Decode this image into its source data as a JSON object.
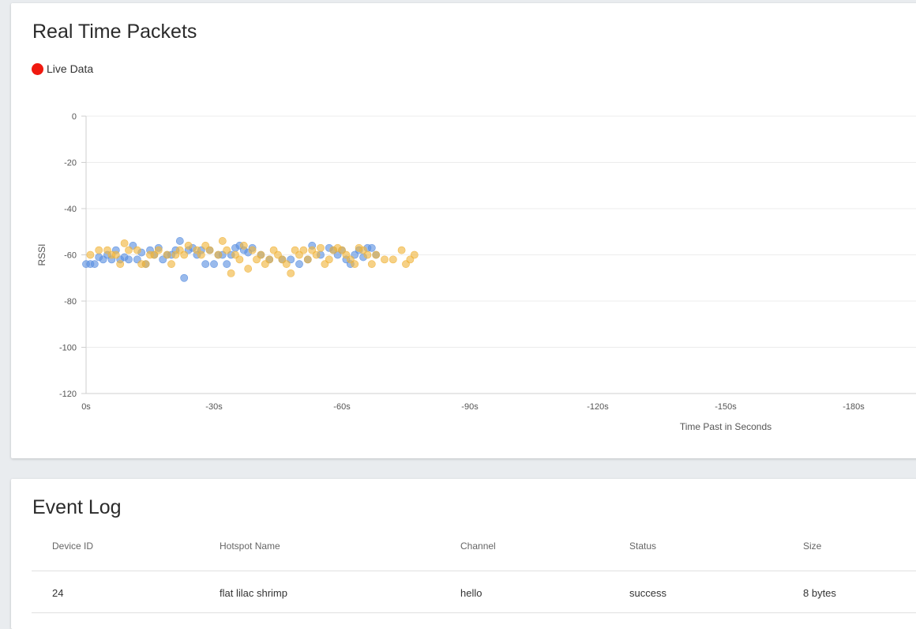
{
  "packets_card": {
    "title": "Real Time Packets",
    "legend_label": "Live Data"
  },
  "colors": {
    "live_dot": "#f0190f",
    "series_blue": "#5a8fe0",
    "series_orange": "#f0b43c"
  },
  "chart_data": {
    "type": "scatter",
    "xlabel": "Time Past in Seconds",
    "ylabel": "RSSI",
    "x_ticks": [
      "0s",
      "-30s",
      "-60s",
      "-90s",
      "-120s",
      "-150s",
      "-180s"
    ],
    "y_ticks": [
      0,
      -20,
      -40,
      -60,
      -80,
      -100,
      -120
    ],
    "xlim": [
      0,
      -195
    ],
    "ylim": [
      -120,
      0
    ],
    "grid": true,
    "series": [
      {
        "color": "#5a8fe0",
        "points": [
          [
            0,
            -64
          ],
          [
            1,
            -64
          ],
          [
            2,
            -64
          ],
          [
            3,
            -61
          ],
          [
            4,
            -62
          ],
          [
            5,
            -60
          ],
          [
            6,
            -62
          ],
          [
            7,
            -58
          ],
          [
            8,
            -62
          ],
          [
            9,
            -61
          ],
          [
            10,
            -62
          ],
          [
            11,
            -56
          ],
          [
            12,
            -62
          ],
          [
            13,
            -59
          ],
          [
            14,
            -64
          ],
          [
            15,
            -58
          ],
          [
            16,
            -60
          ],
          [
            17,
            -57
          ],
          [
            18,
            -62
          ],
          [
            19,
            -60
          ],
          [
            20,
            -60
          ],
          [
            21,
            -58
          ],
          [
            22,
            -54
          ],
          [
            23,
            -70
          ],
          [
            24,
            -58
          ],
          [
            25,
            -57
          ],
          [
            26,
            -60
          ],
          [
            27,
            -58
          ],
          [
            28,
            -64
          ],
          [
            29,
            -58
          ],
          [
            30,
            -64
          ],
          [
            31,
            -60
          ],
          [
            32,
            -60
          ],
          [
            33,
            -64
          ],
          [
            34,
            -60
          ],
          [
            35,
            -57
          ],
          [
            36,
            -56
          ],
          [
            37,
            -58
          ],
          [
            38,
            -59
          ],
          [
            39,
            -57
          ],
          [
            41,
            -60
          ],
          [
            43,
            -62
          ],
          [
            46,
            -62
          ],
          [
            48,
            -62
          ],
          [
            50,
            -64
          ],
          [
            52,
            -62
          ],
          [
            53,
            -56
          ],
          [
            55,
            -60
          ],
          [
            57,
            -57
          ],
          [
            58,
            -58
          ],
          [
            59,
            -60
          ],
          [
            60,
            -58
          ],
          [
            61,
            -62
          ],
          [
            62,
            -64
          ],
          [
            63,
            -60
          ],
          [
            64,
            -58
          ],
          [
            65,
            -61
          ],
          [
            66,
            -57
          ],
          [
            67,
            -57
          ],
          [
            68,
            -60
          ]
        ]
      },
      {
        "color": "#f0b43c",
        "points": [
          [
            1,
            -60
          ],
          [
            3,
            -58
          ],
          [
            5,
            -58
          ],
          [
            6,
            -60
          ],
          [
            7,
            -60
          ],
          [
            8,
            -64
          ],
          [
            9,
            -55
          ],
          [
            10,
            -58
          ],
          [
            12,
            -58
          ],
          [
            13,
            -64
          ],
          [
            14,
            -64
          ],
          [
            15,
            -60
          ],
          [
            16,
            -60
          ],
          [
            17,
            -58
          ],
          [
            19,
            -60
          ],
          [
            20,
            -64
          ],
          [
            21,
            -60
          ],
          [
            22,
            -58
          ],
          [
            23,
            -60
          ],
          [
            24,
            -56
          ],
          [
            26,
            -58
          ],
          [
            27,
            -60
          ],
          [
            28,
            -56
          ],
          [
            29,
            -58
          ],
          [
            31,
            -60
          ],
          [
            32,
            -54
          ],
          [
            33,
            -58
          ],
          [
            34,
            -68
          ],
          [
            35,
            -60
          ],
          [
            36,
            -62
          ],
          [
            37,
            -56
          ],
          [
            38,
            -66
          ],
          [
            39,
            -58
          ],
          [
            40,
            -62
          ],
          [
            41,
            -60
          ],
          [
            42,
            -64
          ],
          [
            43,
            -62
          ],
          [
            44,
            -58
          ],
          [
            45,
            -60
          ],
          [
            46,
            -62
          ],
          [
            47,
            -64
          ],
          [
            48,
            -68
          ],
          [
            49,
            -58
          ],
          [
            50,
            -60
          ],
          [
            51,
            -58
          ],
          [
            52,
            -62
          ],
          [
            53,
            -58
          ],
          [
            54,
            -60
          ],
          [
            55,
            -57
          ],
          [
            56,
            -64
          ],
          [
            57,
            -62
          ],
          [
            58,
            -58
          ],
          [
            59,
            -57
          ],
          [
            60,
            -58
          ],
          [
            61,
            -60
          ],
          [
            62,
            -62
          ],
          [
            63,
            -64
          ],
          [
            64,
            -57
          ],
          [
            65,
            -58
          ],
          [
            66,
            -60
          ],
          [
            67,
            -64
          ],
          [
            68,
            -60
          ],
          [
            70,
            -62
          ],
          [
            72,
            -62
          ],
          [
            74,
            -58
          ],
          [
            75,
            -64
          ],
          [
            76,
            -62
          ],
          [
            77,
            -60
          ]
        ]
      }
    ]
  },
  "event_log": {
    "title": "Event Log",
    "columns": [
      "Device ID",
      "Hotspot Name",
      "Channel",
      "Status",
      "Size"
    ],
    "rows": [
      [
        "24",
        "flat lilac shrimp",
        "hello",
        "success",
        "8 bytes"
      ]
    ]
  }
}
